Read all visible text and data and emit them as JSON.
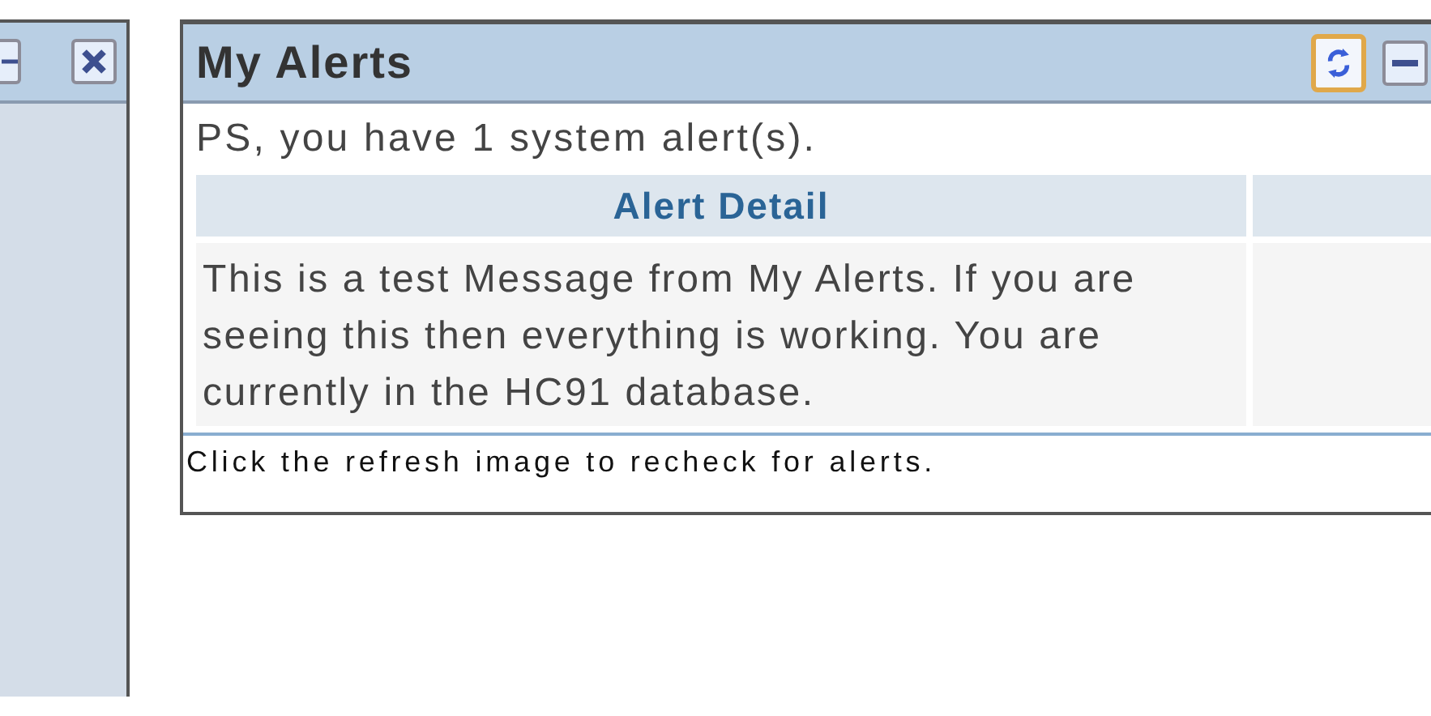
{
  "left_panel": {
    "buttons": [
      {
        "kind": "minimize"
      },
      {
        "kind": "close"
      }
    ]
  },
  "alerts_panel": {
    "title": "My Alerts",
    "buttons": [
      {
        "kind": "refresh",
        "focused": true
      },
      {
        "kind": "minimize",
        "focused": false
      }
    ],
    "summary": "PS, you have 1 system alert(s).",
    "table": {
      "columns": [
        "Alert Detail"
      ],
      "rows": [
        [
          "This is a test Message from My Alerts. If you are seeing this then everything is working. You are currently in the HC91 database."
        ]
      ]
    },
    "footer": "Click the refresh image to recheck for alerts."
  }
}
